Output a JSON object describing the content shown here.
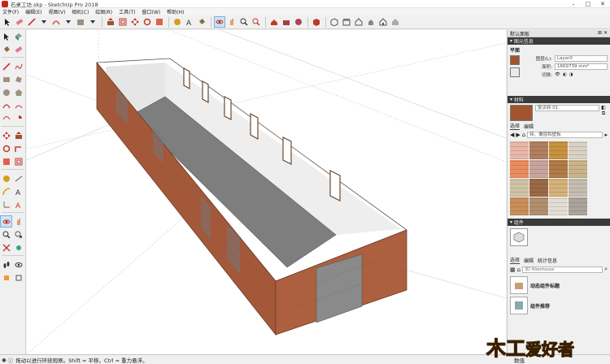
{
  "window": {
    "title": "石桌工坊.skp - SketchUp Pro 2018"
  },
  "menu": [
    "文件(F)",
    "编辑(E)",
    "视图(V)",
    "相机(C)",
    "绘图(R)",
    "工具(T)",
    "窗口(W)",
    "帮助(H)"
  ],
  "tray": {
    "title": "默认面板",
    "entity_info": {
      "heading": "图元信息",
      "type": "平面",
      "layer_label": "图层(L):",
      "layer_value": "Layer0",
      "area_label": "面积:",
      "area_value": "1669739 mm²",
      "toggles_label": "切换:"
    },
    "materials": {
      "heading": "材料",
      "name_value": "复古砖 01",
      "tabs": [
        "选择",
        "编辑"
      ],
      "collection": "砖、覆层和壁板",
      "swatch_colors": [
        "#e8b8a8",
        "#b08060",
        "#c9923e",
        "#d8d2c4",
        "#e98d5e",
        "#c7a49c",
        "#b27a45",
        "#c9b48a",
        "#cfc3a6",
        "#9a6a45",
        "#d6b27a",
        "#c4bdb2",
        "#c98f5a",
        "#b19070",
        "#e3ddd3",
        "#aaa49b"
      ]
    },
    "components": {
      "heading": "组件",
      "tabs": [
        "选择",
        "编辑",
        "统计信息"
      ],
      "search_placeholder": "3D Warehouse",
      "items": [
        {
          "label": "动态组件标题"
        },
        {
          "label": "组件推荐"
        }
      ]
    }
  },
  "status": {
    "hint": "拖动以进行环绕观察。Shift = 平移。Ctrl = 重力悬浮。",
    "vcb_label": "数值"
  },
  "logo_text": {
    "part1": "木工",
    "part2": "爱好者"
  },
  "colors": {
    "accent": "#cde3f7",
    "brick": "#a0552f",
    "floor": "#8a8a8a"
  }
}
